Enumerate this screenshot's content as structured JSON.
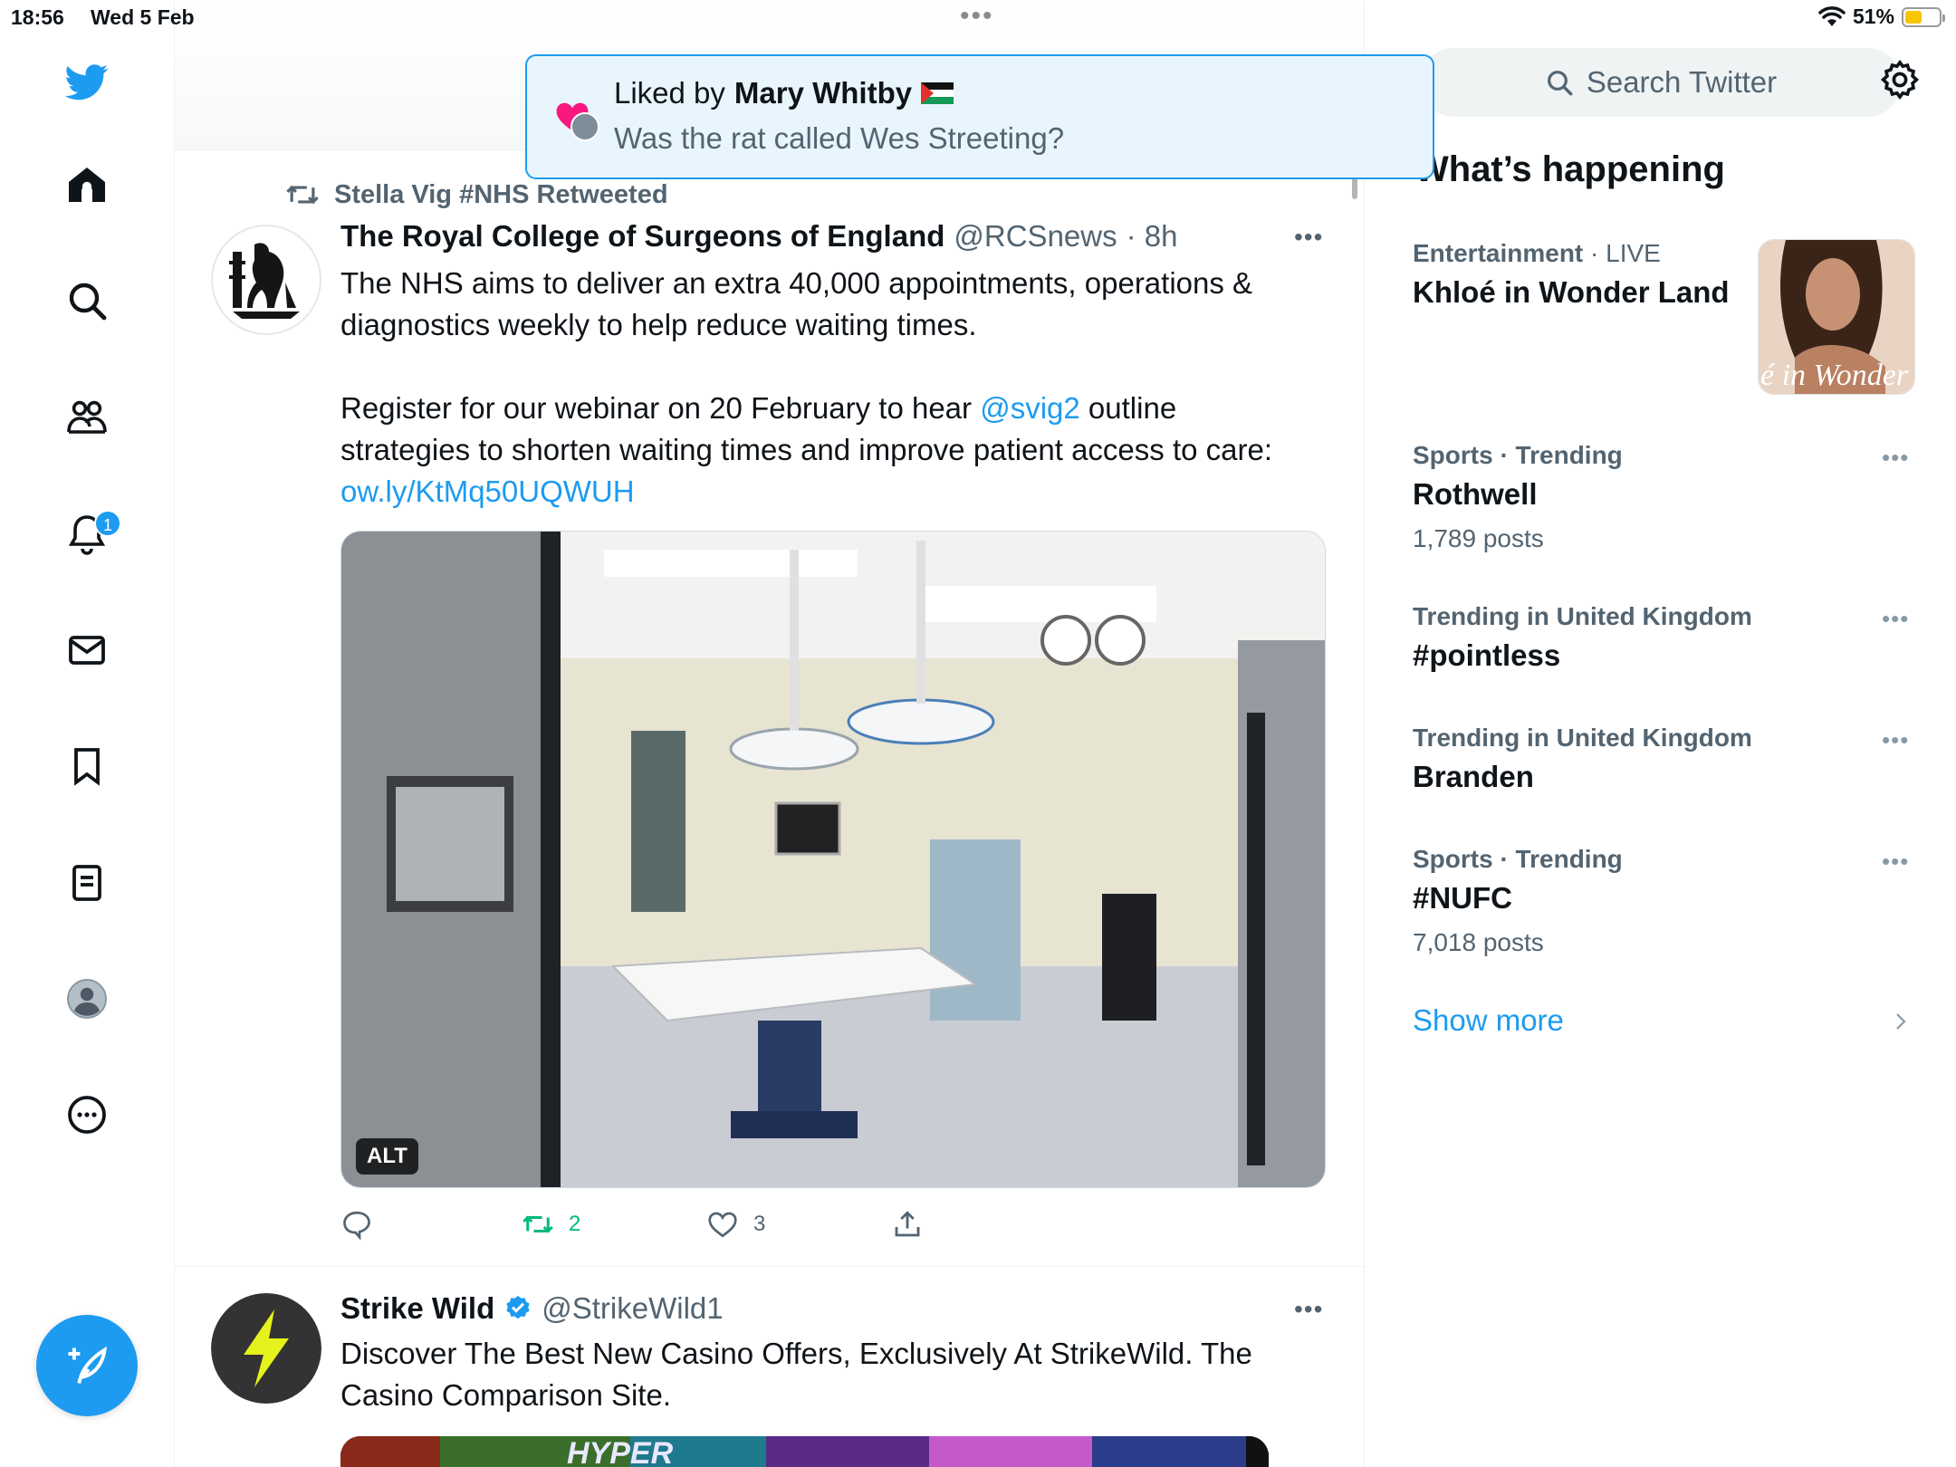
{
  "status_bar": {
    "time": "18:56",
    "date": "Wed 5 Feb",
    "battery": "51%",
    "battery_level": 0.51
  },
  "nav": {
    "items": [
      {
        "name": "twitter-logo-icon"
      },
      {
        "name": "home-icon"
      },
      {
        "name": "search-icon"
      },
      {
        "name": "communities-icon"
      },
      {
        "name": "notifications-icon",
        "badge": "1"
      },
      {
        "name": "messages-icon"
      },
      {
        "name": "bookmarks-icon"
      },
      {
        "name": "lists-icon"
      },
      {
        "name": "profile-icon"
      },
      {
        "name": "more-icon"
      }
    ],
    "compose_icon": "compose-feather-icon"
  },
  "toast": {
    "prefix": "Liked by",
    "user": "Mary Whitby",
    "text": "Was the rat called Wes Streeting?"
  },
  "tweets": [
    {
      "retweeted_by": "Stella Vig #NHS Retweeted",
      "name": "The Royal College of Surgeons of England",
      "handle": "@RCSnews",
      "time": "· 8h",
      "text_line1": "The NHS aims to deliver an extra 40,000 appointments, operations &",
      "text_line2": "diagnostics weekly to help reduce waiting times.",
      "text_line3a": "Register for our webinar on 20 February to hear",
      "mention": "@svig2",
      "text_line3b": "outline",
      "text_line4": "strategies to shorten waiting times and improve patient access to care:",
      "link": "ow.ly/KtMq50UQWUH",
      "alt": "ALT",
      "retweets": "2",
      "likes": "3"
    },
    {
      "name": "Strike Wild",
      "handle": "@StrikeWild1",
      "text_line1": "Discover The Best New Casino Offers, Exclusively At StrikeWild. The",
      "text_line2": "Casino Comparison Site.",
      "media_text": "HYPER"
    }
  ],
  "sidebar": {
    "search_placeholder": "Search Twitter",
    "title": "What’s happening",
    "trends": [
      {
        "category": "Entertainment",
        "sep": " · ",
        "label": "LIVE",
        "name": "Khloé in Wonder Land",
        "image_caption": "é in Wonder L"
      },
      {
        "category": "Sports · Trending",
        "name": "Rothwell",
        "count": "1,789 posts"
      },
      {
        "category": "Trending in United Kingdom",
        "name": "#pointless"
      },
      {
        "category": "Trending in United Kingdom",
        "name": "Branden"
      },
      {
        "category": "Sports · Trending",
        "name": "#NUFC",
        "count": "7,018 posts"
      }
    ],
    "show_more": "Show more"
  },
  "colors": {
    "accent": "#1d9bf0",
    "retweet_green": "#00ba7c",
    "secondary_text": "#536471"
  }
}
